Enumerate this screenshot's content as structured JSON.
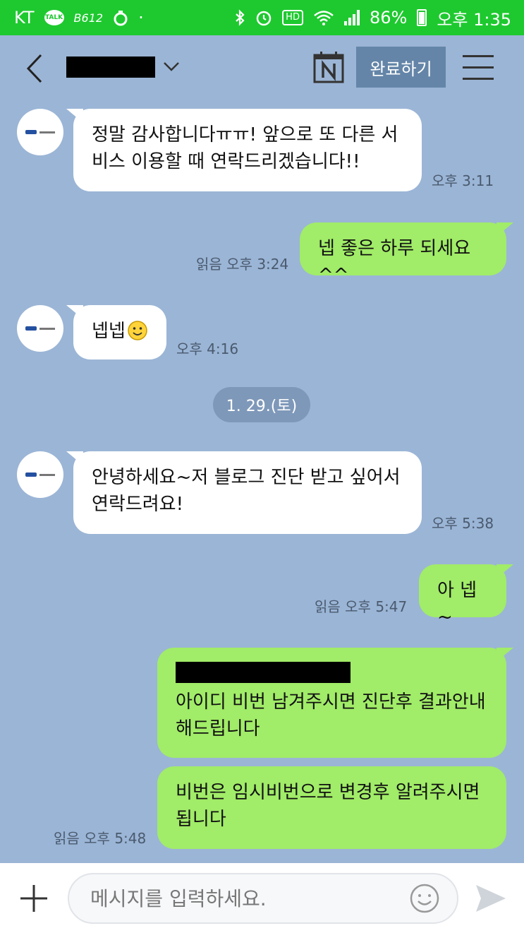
{
  "status_bar": {
    "carrier": "KT",
    "talk_badge": "TALK",
    "app_badge": "B612",
    "hd": "HD",
    "battery": "86%",
    "time": "오후 1:35"
  },
  "header": {
    "done_label": "완료하기"
  },
  "messages": [
    {
      "id": "m1",
      "text": "정말 감사합니다ㅠㅠ! 앞으로 또 다른 서비스 이용할 때 연락드리겠습니다!!",
      "time": "오후 3:11"
    },
    {
      "id": "m2",
      "text": "넵 좋은 하루 되세요^^",
      "time": "읽음 오후 3:24"
    },
    {
      "id": "m3",
      "text": "넵넵",
      "time": "오후 4:16"
    },
    {
      "id": "m4",
      "text": "안녕하세요~저 블로그 진단 받고 싶어서 연락드려요!",
      "time": "오후 5:38"
    },
    {
      "id": "m5",
      "text": "아 넵~",
      "time": "읽음 오후 5:47"
    },
    {
      "id": "m6",
      "text": "아이디 비번 남겨주시면 진단후 결과안내해드립니다",
      "time": ""
    },
    {
      "id": "m7",
      "text": "비번은 임시비번으로 변경후 알려주시면 됩니다",
      "time": "읽음 오후 5:48"
    }
  ],
  "date_divider": "1. 29.(토)",
  "input": {
    "placeholder": "메시지를 입력하세요."
  },
  "colors": {
    "status_bar": "#1ec92f",
    "background": "#9bb5d6",
    "outgoing_bubble": "#a1ec68",
    "incoming_bubble": "#ffffff",
    "done_button": "#6485a8",
    "date_pill": "#7e98b9"
  }
}
